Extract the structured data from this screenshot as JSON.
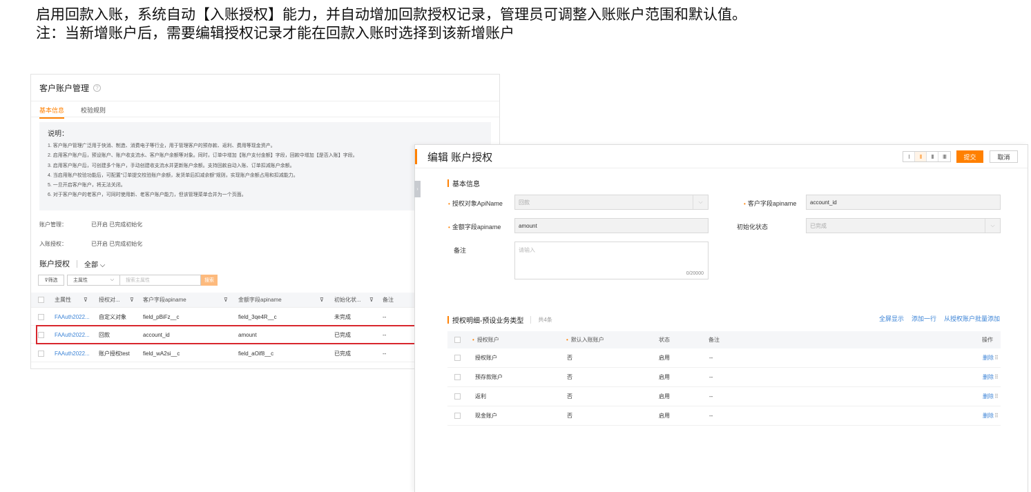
{
  "header": {
    "line1": "启用回款入账，系统自动【入账授权】能力，并自动增加回款授权记录，管理员可调整入账账户范围和默认值。",
    "line2": "注：当新增账户后，需要编辑授权记录才能在回款入账时选择到该新增账户"
  },
  "left_panel": {
    "title": "客户账户管理",
    "tabs": [
      "基本信息",
      "校验规则"
    ],
    "explain_title": "说明：",
    "explain_lines": [
      "1. 客户账户管理广泛用于快消、制造、消费电子等行业，用于管理客户的预存款、返利、费用等现金资产。",
      "2. 启用客户账户后，预设账户、账户收支流水、客户账户余额等对象。同时，订单中增加【账户支付金额】字段，回款中增加【是否入账】字段。",
      "3. 启用客户账户后，可创建多个账户，手动创建收支流水并更新账户余额。支持回款自动入账、订单扣减账户余额。",
      "4. 当启用账户校验功能后，可配置\"订单提交校验账户余额，发货单后扣减余额\"规则，实现账户余额占用和扣减能力。",
      "5. 一旦开启客户账户，将无法关闭。",
      "6. 对于客户账户的老客户，可同时使用新、老客户账户能力，但该管理菜单合并为一个页面。"
    ],
    "account_mgmt_label": "账户管理：",
    "account_mgmt_value": "已开启  已完成初始化",
    "entry_auth_label": "入账授权：",
    "entry_auth_value": "已开启  已完成初始化",
    "section_title": "账户授权",
    "section_filter": "全部",
    "filter_button": "筛选",
    "select_value": "主属性",
    "search_placeholder": "搜索主属性",
    "search_button": "搜索",
    "table": {
      "headers": [
        "主属性",
        "授权对...",
        "客户字段apiname",
        "金额字段apiname",
        "初始化状...",
        "备注"
      ],
      "rows": [
        [
          "FAAuth2022...",
          "自定义对象",
          "field_pBiFz__c",
          "field_3qe4R__c",
          "未完成",
          "--"
        ],
        [
          "FAAuth2022...",
          "回款",
          "account_id",
          "amount",
          "已完成",
          "--"
        ],
        [
          "FAAuth2022...",
          "账户授权test",
          "field_wA2si__c",
          "field_aOif8__c",
          "已完成",
          "--"
        ]
      ]
    }
  },
  "right_panel": {
    "title": "编辑 账户授权",
    "layout_options": [
      "I",
      "II",
      "III",
      "IIII"
    ],
    "submit_label": "提交",
    "cancel_label": "取消",
    "basic_info_title": "基本信息",
    "fields": {
      "auth_object_label": "授权对象ApiName",
      "auth_object_value": "回款",
      "customer_field_label": "客户字段apiname",
      "customer_field_value": "account_id",
      "amount_field_label": "金额字段apiname",
      "amount_field_value": "amount",
      "init_status_label": "初始化状态",
      "init_status_value": "已完成",
      "remark_label": "备注",
      "remark_placeholder": "请输入",
      "remark_counter": "0/20000"
    },
    "detail": {
      "title": "授权明细-预设业务类型",
      "count": "共4条",
      "actions": [
        "全屏显示",
        "添加一行",
        "从授权账户批量添加"
      ],
      "headers": [
        "授权账户",
        "默认入账账户",
        "状态",
        "备注",
        "操作"
      ],
      "rows": [
        [
          "授权账户",
          "否",
          "启用",
          "--",
          "删除"
        ],
        [
          "预存款账户",
          "否",
          "启用",
          "--",
          "删除"
        ],
        [
          "返利",
          "否",
          "启用",
          "--",
          "删除"
        ],
        [
          "现金账户",
          "否",
          "启用",
          "--",
          "删除"
        ]
      ]
    }
  }
}
